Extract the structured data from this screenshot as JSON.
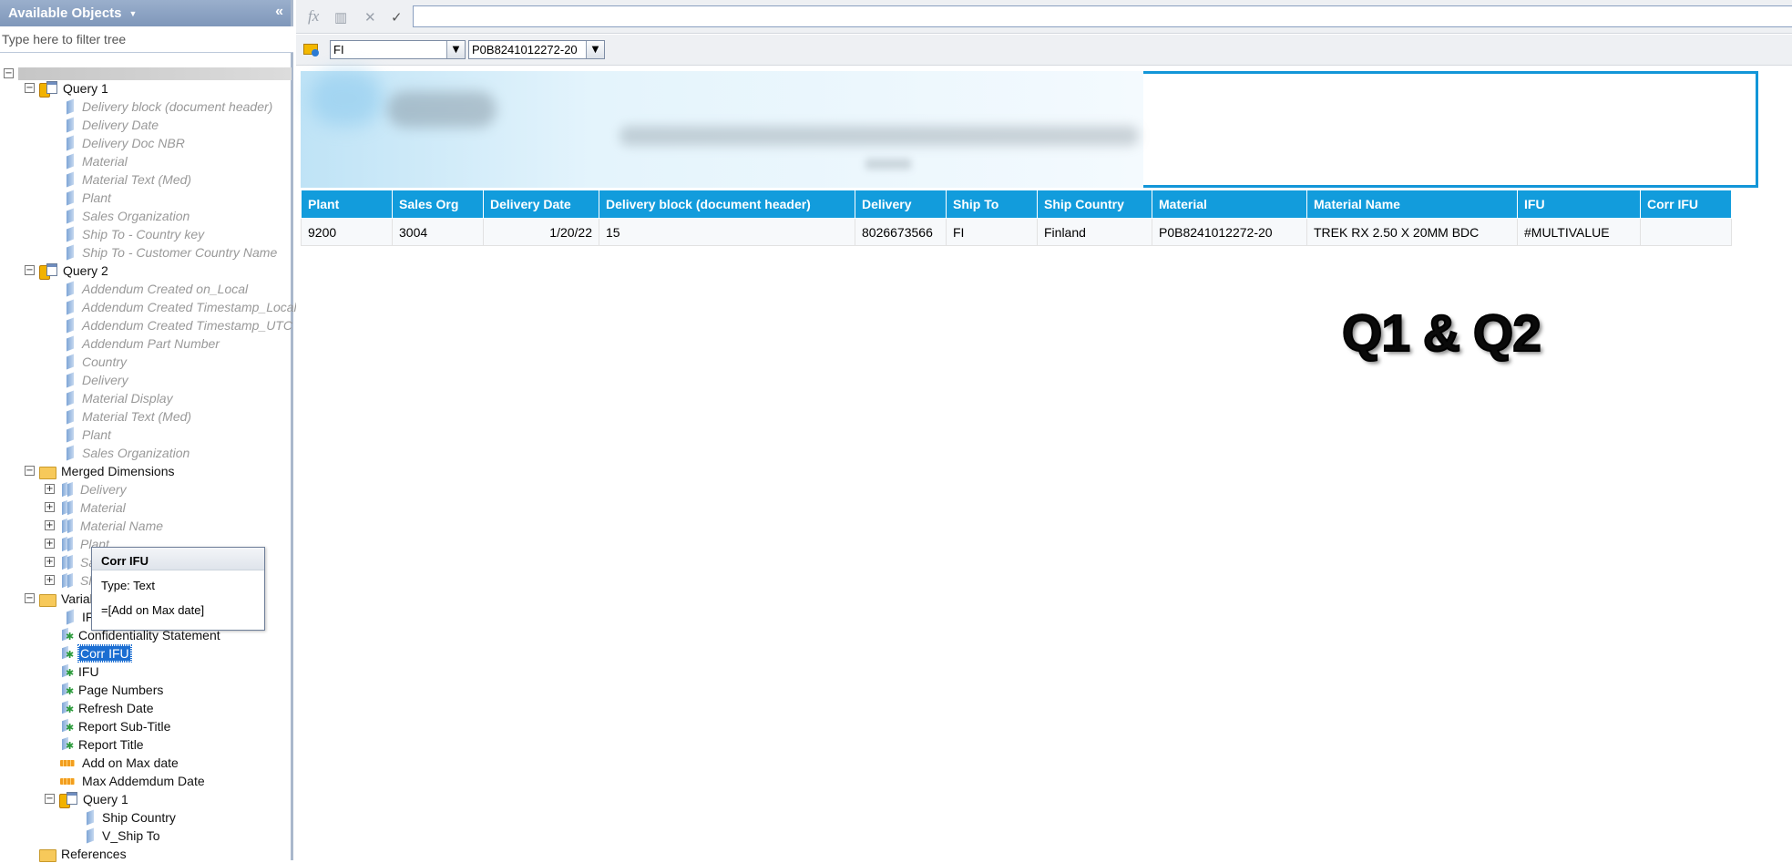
{
  "left_panel": {
    "title": "Available Objects",
    "filter_placeholder": "Type here to filter tree",
    "root_label": "",
    "query1": {
      "label": "Query 1",
      "items": [
        "Delivery block (document header)",
        "Delivery Date",
        "Delivery Doc NBR",
        "Material",
        "Material Text (Med)",
        "Plant",
        "Sales Organization",
        "Ship To - Country key",
        "Ship To - Customer Country Name"
      ]
    },
    "query2": {
      "label": "Query 2",
      "items": [
        "Addendum Created on_Local",
        "Addendum Created Timestamp_Local",
        "Addendum Created Timestamp_UTC",
        "Addendum Part Number",
        "Country",
        "Delivery",
        "Material Display",
        "Material Text (Med)",
        "Plant",
        "Sales Organization"
      ]
    },
    "merged": {
      "label": "Merged Dimensions",
      "items": [
        "Delivery",
        "Material",
        "Material Name",
        "Plant",
        "Sa",
        "Sh"
      ]
    },
    "variables": {
      "label": "Variab",
      "items": [
        "IF",
        "Confidentiality Statement",
        "Corr IFU",
        "IFU",
        "Page Numbers",
        "Refresh Date",
        "Report Sub-Title",
        "Report Title",
        "Add on Max date",
        "Max Addemdum Date"
      ],
      "query1": {
        "label": "Query 1",
        "items": [
          "Ship Country",
          "V_Ship To"
        ]
      }
    },
    "references": {
      "label": "References"
    },
    "tooltip": {
      "title": "Corr IFU",
      "type": "Type: Text",
      "formula": "=[Add on Max date]"
    }
  },
  "toolbar": {
    "fx": "fx",
    "cancel": "✕",
    "ok": "✓",
    "formula_value": ""
  },
  "filter_bar": {
    "dropdown1": "FI",
    "dropdown2": "P0B8241012272-20"
  },
  "table": {
    "headers": [
      "Plant",
      "Sales Org",
      "Delivery Date",
      "Delivery block (document header)",
      "Delivery",
      "Ship To",
      "Ship Country",
      "Material",
      "Material Name",
      "IFU",
      "Corr IFU"
    ],
    "row": [
      "9200",
      "3004",
      "1/20/22",
      "15",
      "8026673566",
      "FI",
      "Finland",
      "P0B8241012272-20",
      "TREK RX 2.50 X 20MM BDC",
      "#MULTIVALUE",
      ""
    ]
  },
  "annotation": "Q1 & Q2",
  "colors": {
    "header_blue": "#129cdc",
    "panel_header": "#8aa1c4",
    "selection": "#1b6ed2"
  }
}
